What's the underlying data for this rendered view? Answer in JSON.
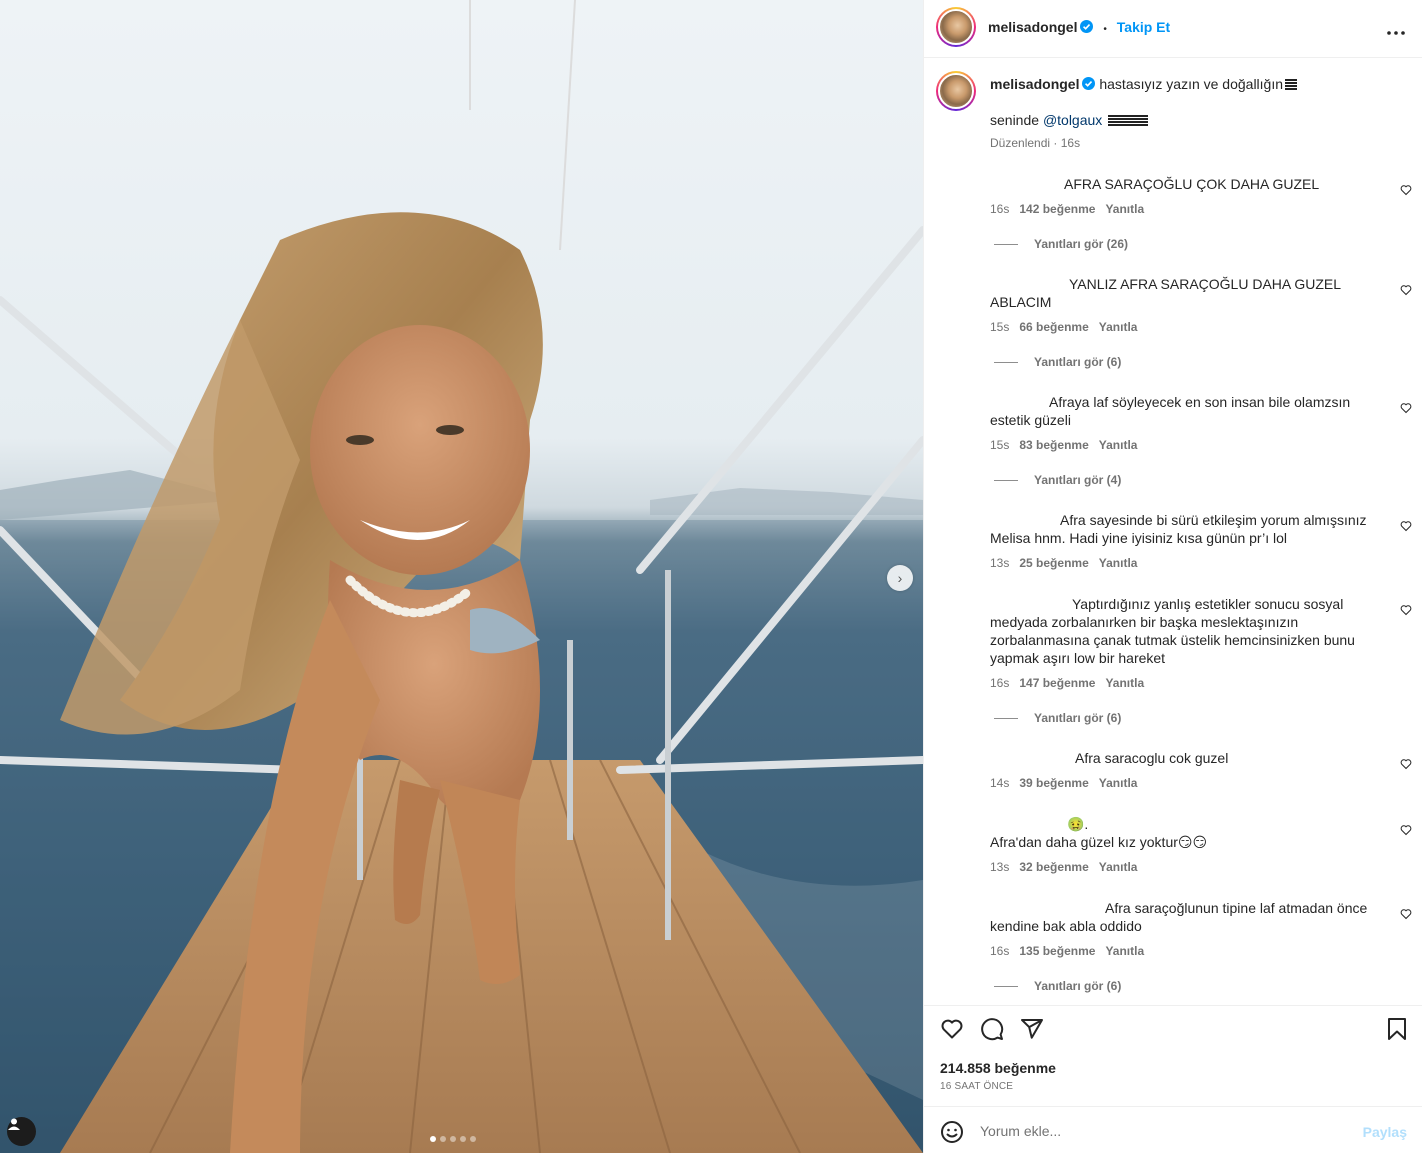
{
  "post_author": {
    "username": "melisadongel",
    "follow_label": "Takip Et",
    "separator": "•"
  },
  "caption": {
    "username": "melisadongel",
    "line1": "hastasıyız yazın ve doğallığın",
    "line2_prefix": "seninde",
    "mention": "@tolgaux",
    "edited": "Düzenlendi",
    "time": "16s"
  },
  "comments": [
    {
      "text": "AFRA SARAÇOĞLU ÇOK DAHA GUZEL",
      "time": "16s",
      "likes": "142 beğenme",
      "reply": "Yanıtla",
      "replies": "Yanıtları gör (26)"
    },
    {
      "text": "YANLIZ AFRA SARAÇOĞLU DAHA GUZEL",
      "text2": "ABLACIM",
      "time": "15s",
      "likes": "66 beğenme",
      "reply": "Yanıtla",
      "replies": "Yanıtları gör (6)"
    },
    {
      "text": "Afraya laf söyleyecek en son insan bile olamzsın",
      "text2": "estetik güzeli",
      "time": "15s",
      "likes": "83 beğenme",
      "reply": "Yanıtla",
      "replies": "Yanıtları gör (4)"
    },
    {
      "text": "Afra sayesinde bi sürü etkileşim yorum almışsınız",
      "text2": "Melisa hnm. Hadi yine iyisiniz kısa günün pr’ı lol",
      "time": "13s",
      "likes": "25 beğenme",
      "reply": "Yanıtla"
    },
    {
      "text": "Yaptırdığınız yanlış estetikler sonucu sosyal",
      "text2": "medyada zorbalanırken bir başka meslektaşınızın",
      "text3": "zorbalanmasına çanak tutmak üstelik hemcinsinizken bunu",
      "text4": "yapmak aşırı low bir hareket",
      "time": "16s",
      "likes": "147 beğenme",
      "reply": "Yanıtla",
      "replies": "Yanıtları gör (6)"
    },
    {
      "text": "Afra saracoglu cok guzel",
      "time": "14s",
      "likes": "39 beğenme",
      "reply": "Yanıtla"
    },
    {
      "text": "🤢.",
      "text2": "Afra'dan daha güzel kız yoktur😏😏",
      "time": "13s",
      "likes": "32 beğenme",
      "reply": "Yanıtla"
    },
    {
      "text": "Afra saraçoğlunun tipine laf atmadan önce",
      "text2": "kendine bak abla oddido",
      "time": "16s",
      "likes": "135 beğenme",
      "reply": "Yanıtla",
      "replies": "Yanıtları gör (6)"
    }
  ],
  "footer": {
    "likes": "214.858 beğenme",
    "time_ago": "16 SAAT ÖNCE",
    "comment_placeholder": "Yorum ekle...",
    "share_label": "Paylaş"
  },
  "carousel": {
    "count": 5,
    "active": 0
  },
  "colors": {
    "accent": "#0095f6",
    "muted": "#737373",
    "share_disabled": "#b2dffc"
  },
  "icons": [
    "heart-icon",
    "comment-icon",
    "share-icon",
    "bookmark-icon",
    "emoji-icon",
    "verified-icon",
    "more-icon",
    "chevron-right-icon",
    "user-tag-icon"
  ]
}
